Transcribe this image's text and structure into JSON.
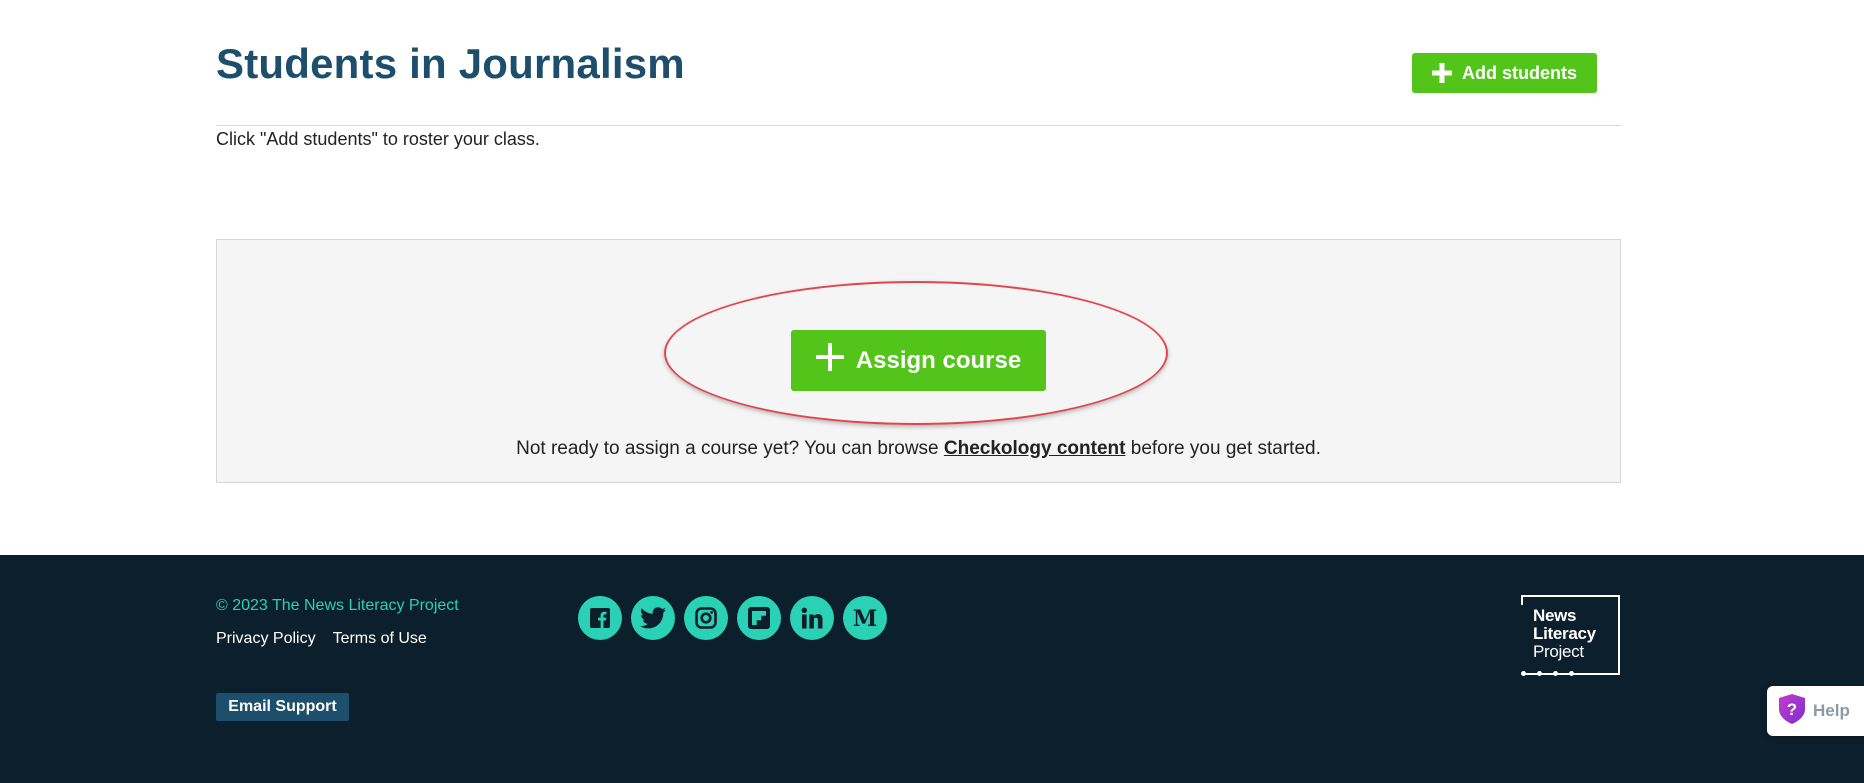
{
  "header": {
    "title": "Students in Journalism",
    "add_students_label": "Add students",
    "roster_hint": "Click \"Add students\" to roster your class."
  },
  "course_panel": {
    "assign_course_label": "Assign course",
    "browse_prefix": "Not ready to assign a course yet? You can browse ",
    "browse_link": "Checkology content",
    "browse_suffix": " before you get started."
  },
  "footer": {
    "copyright": "© 2023 The News Literacy Project",
    "links": [
      "Privacy Policy",
      "Terms of Use"
    ],
    "email_support_label": "Email Support",
    "social_icons": [
      "facebook-icon",
      "twitter-icon",
      "instagram-icon",
      "flipboard-icon",
      "linkedin-icon",
      "medium-icon"
    ],
    "logo": {
      "line1": "News",
      "line2": "Literacy",
      "line3": "Project"
    }
  },
  "help_widget": {
    "label": "Help"
  },
  "colors": {
    "title": "#1d4e6b",
    "green_button": "#52c41a",
    "footer_bg": "#0c1f2c",
    "accent_teal": "#2ad1b4",
    "annotation_red": "#e0474c"
  }
}
